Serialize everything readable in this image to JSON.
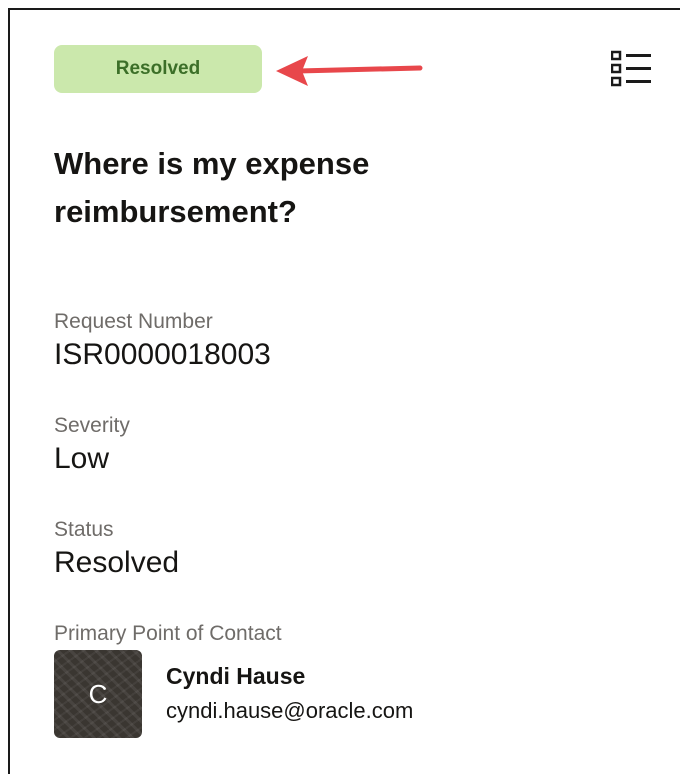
{
  "status_badge": {
    "label": "Resolved",
    "bg_color": "#cbe8ac",
    "text_color": "#3c6f28"
  },
  "annotation": {
    "arrow_color": "#e8474b"
  },
  "header": {
    "menu_icon": "list-icon"
  },
  "title": "Where is my expense reimbursement?",
  "fields": [
    {
      "label": "Request Number",
      "value": "ISR0000018003"
    },
    {
      "label": "Severity",
      "value": "Low"
    },
    {
      "label": "Status",
      "value": "Resolved"
    }
  ],
  "contact": {
    "label": "Primary Point of Contact",
    "avatar_initial": "C",
    "name": "Cyndi Hause",
    "email": "cyndi.hause@oracle.com"
  }
}
